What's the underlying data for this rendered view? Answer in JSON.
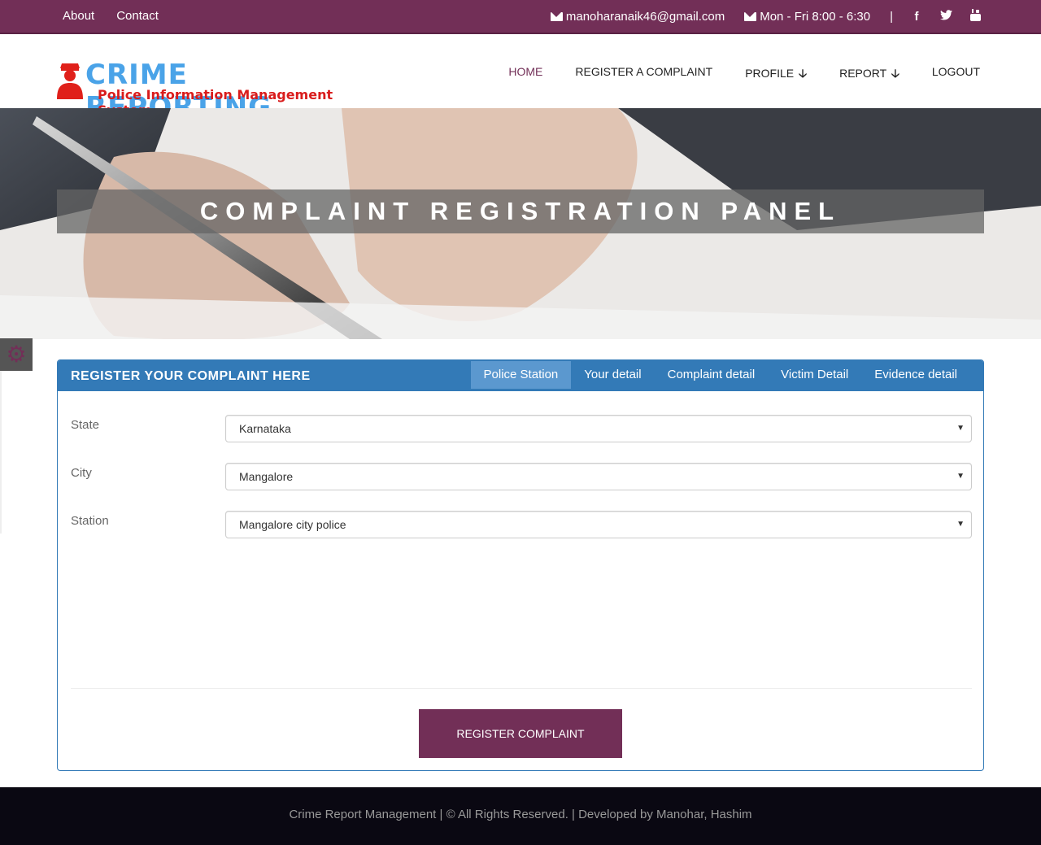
{
  "topbar": {
    "links": [
      "About",
      "Contact"
    ],
    "email": "manoharanaik46@gmail.com",
    "hours": "Mon - Fri 8:00 - 6:30",
    "separator": "|",
    "social": [
      {
        "icon": "facebook-icon",
        "glyph": "f"
      },
      {
        "icon": "twitter-icon",
        "glyph": "t"
      },
      {
        "icon": "youtube-icon",
        "glyph": "y"
      }
    ],
    "color": "#722f57"
  },
  "logo": {
    "title": "CRIME REPORTING",
    "subtitle": "Police Information Management System",
    "title_color": "#4aa3e8",
    "subtitle_color": "#d91c1c",
    "icon": "police-officer-icon"
  },
  "nav": {
    "items": [
      {
        "label": "HOME",
        "active": true
      },
      {
        "label": "REGISTER A COMPLAINT",
        "active": false
      },
      {
        "label": "PROFILE",
        "active": false,
        "dropdown": true
      },
      {
        "label": "REPORT",
        "active": false,
        "dropdown": true
      },
      {
        "label": "LOGOUT",
        "active": false
      }
    ],
    "dropdown_arrow": "🡣"
  },
  "banner": {
    "title": "COMPLAINT REGISTRATION PANEL"
  },
  "panel": {
    "title": "REGISTER YOUR COMPLAINT HERE",
    "tabs": [
      {
        "label": "Police Station",
        "active": true
      },
      {
        "label": "Your detail",
        "active": false
      },
      {
        "label": "Complaint detail",
        "active": false
      },
      {
        "label": "Victim Detail",
        "active": false
      },
      {
        "label": "Evidence detail",
        "active": false
      }
    ],
    "fields": [
      {
        "label": "State",
        "value": "Karnataka"
      },
      {
        "label": "City",
        "value": "Mangalore"
      },
      {
        "label": "Station",
        "value": "Mangalore city police"
      }
    ],
    "submit_label": "REGISTER COMPLAINT",
    "header_color": "#337ab7"
  },
  "footer": {
    "text": "Crime Report Management | © All Rights Reserved. | Developed by Manohar, Hashim"
  }
}
